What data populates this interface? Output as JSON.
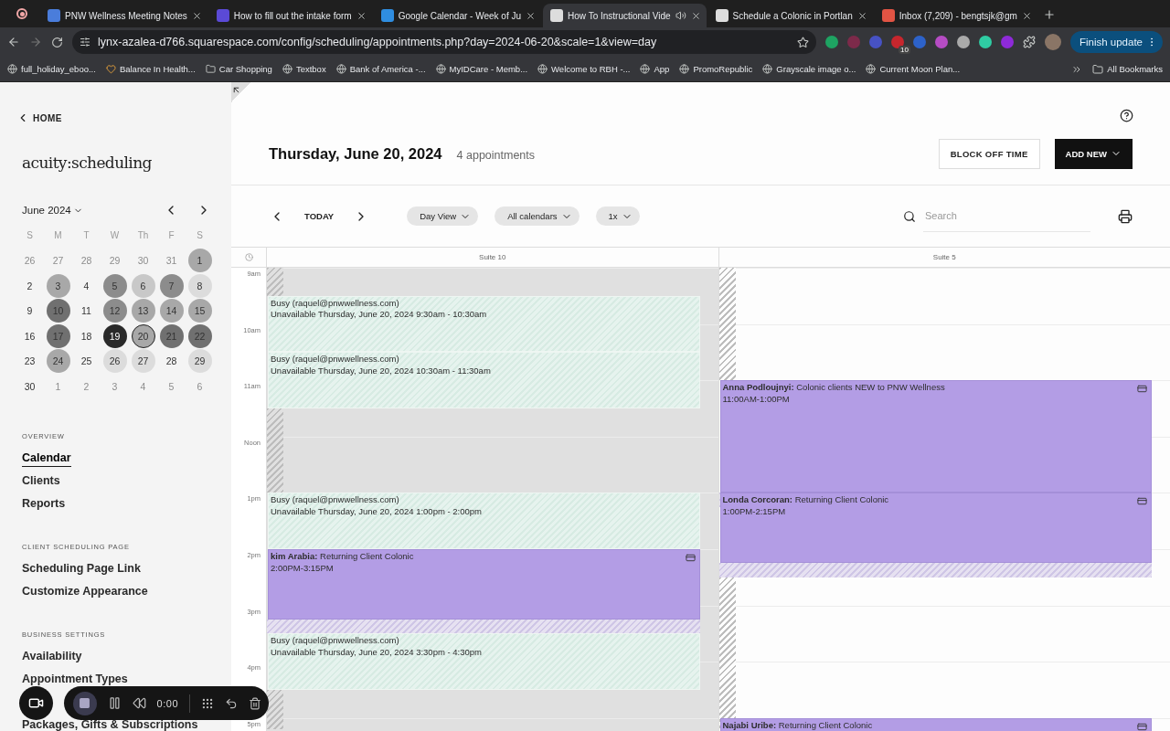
{
  "browser": {
    "tabs": [
      {
        "title": "PNW Wellness Meeting Notes",
        "selected": false,
        "audio": false
      },
      {
        "title": "How to fill out the intake form",
        "selected": false,
        "audio": false
      },
      {
        "title": "Google Calendar - Week of Ju",
        "selected": false,
        "audio": false
      },
      {
        "title": "How To Instructional Vide",
        "selected": true,
        "audio": true
      },
      {
        "title": "Schedule a Colonic in Portlan",
        "selected": false,
        "audio": false
      },
      {
        "title": "Inbox (7,209) - bengtsjk@gm",
        "selected": false,
        "audio": false
      }
    ],
    "url": "lynx-azalea-d766.squarespace.com/config/scheduling/appointments.php?day=2024-06-20&scale=1&view=day",
    "extension_badge": "10",
    "update_button": "Finish update",
    "bookmarks": [
      "full_holiday_eboo...",
      "Balance In Health...",
      "Car Shopping",
      "Textbox",
      "Bank of America -...",
      "MyIDCare - Memb...",
      "Welcome to RBH -...",
      "App",
      "PromoRepublic",
      "Grayscale image o...",
      "Current Moon Plan..."
    ],
    "all_bookmarks": "All Bookmarks"
  },
  "sidebar": {
    "home": "HOME",
    "logo": "acuity:scheduling",
    "mini_calendar": {
      "month": "June 2024",
      "weekdays": [
        "S",
        "M",
        "T",
        "W",
        "Th",
        "F",
        "S"
      ],
      "days": [
        {
          "label": "26",
          "outside": true,
          "selected": false
        },
        {
          "label": "27",
          "outside": true,
          "selected": false
        },
        {
          "label": "28",
          "outside": true,
          "selected": false
        },
        {
          "label": "29",
          "outside": true,
          "selected": false
        },
        {
          "label": "30",
          "outside": true,
          "selected": false
        },
        {
          "label": "31",
          "outside": true,
          "selected": false
        },
        {
          "label": "1",
          "outside": false,
          "selected": false,
          "color": "#a8a8a8"
        },
        {
          "label": "2",
          "outside": false,
          "selected": false
        },
        {
          "label": "3",
          "outside": false,
          "selected": false,
          "color": "#a8a8a8"
        },
        {
          "label": "4",
          "outside": false,
          "selected": false
        },
        {
          "label": "5",
          "outside": false,
          "selected": false,
          "color": "#8c8c8c"
        },
        {
          "label": "6",
          "outside": false,
          "selected": false,
          "color": "#c8c8c8"
        },
        {
          "label": "7",
          "outside": false,
          "selected": false,
          "color": "#8c8c8c"
        },
        {
          "label": "8",
          "outside": false,
          "selected": false,
          "color": "#dcdcdc"
        },
        {
          "label": "9",
          "outside": false,
          "selected": false
        },
        {
          "label": "10",
          "outside": false,
          "selected": false,
          "color": "#707070"
        },
        {
          "label": "11",
          "outside": false,
          "selected": false
        },
        {
          "label": "12",
          "outside": false,
          "selected": false,
          "color": "#8c8c8c"
        },
        {
          "label": "13",
          "outside": false,
          "selected": false,
          "color": "#a8a8a8"
        },
        {
          "label": "14",
          "outside": false,
          "selected": false,
          "color": "#a8a8a8"
        },
        {
          "label": "15",
          "outside": false,
          "selected": false,
          "color": "#a8a8a8"
        },
        {
          "label": "16",
          "outside": false,
          "selected": false
        },
        {
          "label": "17",
          "outside": false,
          "selected": false,
          "color": "#707070"
        },
        {
          "label": "18",
          "outside": false,
          "selected": false
        },
        {
          "label": "19",
          "outside": false,
          "selected": false,
          "color": "#2a2a2a"
        },
        {
          "label": "20",
          "outside": false,
          "selected": true,
          "color": "#a8a8a8"
        },
        {
          "label": "21",
          "outside": false,
          "selected": false,
          "color": "#707070"
        },
        {
          "label": "22",
          "outside": false,
          "selected": false,
          "color": "#707070"
        },
        {
          "label": "23",
          "outside": false,
          "selected": false
        },
        {
          "label": "24",
          "outside": false,
          "selected": false,
          "color": "#a8a8a8"
        },
        {
          "label": "25",
          "outside": false,
          "selected": false
        },
        {
          "label": "26",
          "outside": false,
          "selected": false,
          "color": "#dcdcdc"
        },
        {
          "label": "27",
          "outside": false,
          "selected": false,
          "color": "#dcdcdc"
        },
        {
          "label": "28",
          "outside": false,
          "selected": false
        },
        {
          "label": "29",
          "outside": false,
          "selected": false,
          "color": "#dcdcdc"
        },
        {
          "label": "30",
          "outside": false,
          "selected": false
        },
        {
          "label": "1",
          "outside": true,
          "selected": false
        },
        {
          "label": "2",
          "outside": true,
          "selected": false
        },
        {
          "label": "3",
          "outside": true,
          "selected": false
        },
        {
          "label": "4",
          "outside": true,
          "selected": false
        },
        {
          "label": "5",
          "outside": true,
          "selected": false
        },
        {
          "label": "6",
          "outside": true,
          "selected": false
        }
      ]
    },
    "sections": [
      {
        "heading": "OVERVIEW",
        "items": [
          {
            "label": "Calendar",
            "selected": true
          },
          {
            "label": "Clients",
            "selected": false
          },
          {
            "label": "Reports",
            "selected": false
          }
        ]
      },
      {
        "heading": "CLIENT SCHEDULING PAGE",
        "items": [
          {
            "label": "Scheduling Page Link",
            "selected": false
          },
          {
            "label": "Customize Appearance",
            "selected": false
          }
        ]
      },
      {
        "heading": "BUSINESS SETTINGS",
        "items": [
          {
            "label": "Availability",
            "selected": false
          },
          {
            "label": "Appointment Types",
            "selected": false
          },
          {
            "label": "Packages, Gifts & Subscriptions",
            "selected": false
          }
        ]
      }
    ]
  },
  "header": {
    "date": "Thursday, June 20, 2024",
    "count": "4 appointments",
    "buttons": [
      "BLOCK OFF TIME",
      "ADD NEW"
    ]
  },
  "toolbar": {
    "today": "TODAY",
    "filters": [
      "Day View",
      "All calendars",
      "1x"
    ],
    "search": {
      "placeholder": "Search"
    }
  },
  "hours": [
    "9am",
    "10am",
    "11am",
    "Noon",
    "1pm",
    "2pm",
    "3pm",
    "4pm",
    "5pm"
  ],
  "columns": [
    {
      "name": "Suite 10",
      "events": [
        {
          "kind": "busy",
          "title": "Busy (raquel@pnwwellness.com)",
          "detail": "Unavailable Thursday, June 20, 2024 9:30am - 10:30am"
        },
        {
          "kind": "busy",
          "title": "Busy (raquel@pnwwellness.com)",
          "detail": "Unavailable Thursday, June 20, 2024 10:30am - 11:30am"
        },
        {
          "kind": "busy",
          "title": "Busy (raquel@pnwwellness.com)",
          "detail": "Unavailable Thursday, June 20, 2024 1:00pm - 2:00pm"
        },
        {
          "kind": "appointment",
          "title": "**kim Arabia:**  Returning Client Colonic",
          "time": "2:00PM-3:15PM"
        },
        {
          "kind": "busy",
          "title": "Busy (raquel@pnwwellness.com)",
          "detail": "Unavailable Thursday, June 20, 2024 3:30pm - 4:30pm"
        }
      ]
    },
    {
      "name": "Suite 5",
      "events": [
        {
          "kind": "appointment",
          "title": "**Anna Podloujnyi:**  Colonic clients NEW to PNW Wellness",
          "time": "11:00AM-1:00PM"
        },
        {
          "kind": "appointment",
          "title": "**Londa Corcoran:**  Returning Client Colonic",
          "time": "1:00PM-2:15PM"
        },
        {
          "kind": "appointment",
          "title": "**Najabi Uribe:**  Returning Client Colonic"
        }
      ]
    }
  ],
  "recorder": {
    "time": "0:00"
  }
}
